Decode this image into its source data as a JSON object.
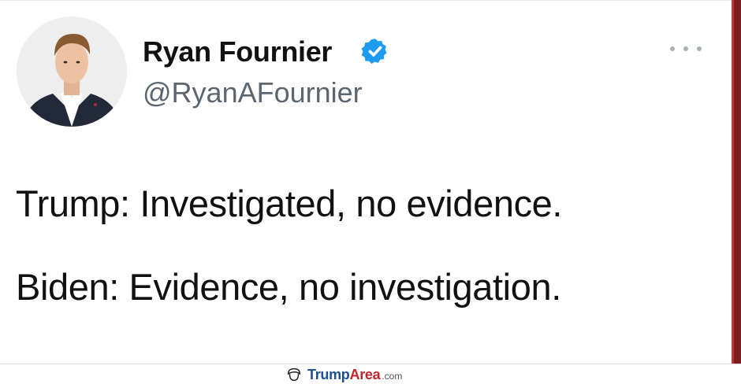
{
  "tweet": {
    "display_name": "Ryan Fournier",
    "handle": "@RyanAFournier",
    "verified": true,
    "lines": [
      "Trump: Investigated, no evidence.",
      "Biden: Evidence, no investigation."
    ],
    "more_icon": "more-horizontal-icon",
    "verified_color": "#1d9bf0"
  },
  "watermark": {
    "brand_part1": "Trump",
    "brand_part2": "Area",
    "suffix": ".com",
    "brand_color": "#1f4f8f",
    "accent_color": "#c0272d"
  }
}
